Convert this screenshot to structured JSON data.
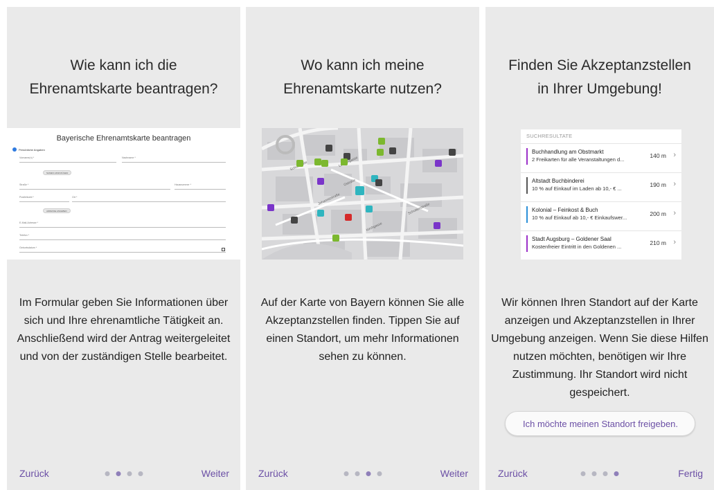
{
  "panels": [
    {
      "title_line1": "Wie kann ich die",
      "title_line2": "Ehrenamtskarte beantragen?",
      "body": "Im Formular geben Sie Informationen über sich und Ihre ehrenamtliche Tätigkeit an. Anschließend wird der Antrag weitergeleitet und von der zuständigen Stelle bearbeitet.",
      "back": "Zurück",
      "next": "Weiter",
      "active_dot": 1
    },
    {
      "title_line1": "Wo kann ich meine",
      "title_line2": "Ehrenamtskarte nutzen?",
      "body": "Auf der Karte von Bayern können Sie alle Akzeptanzstellen finden. Tippen Sie auf einen Standort, um mehr Informationen sehen zu können.",
      "back": "Zurück",
      "next": "Weiter",
      "active_dot": 2
    },
    {
      "title_line1": "Finden Sie Akzeptanzstellen",
      "title_line2": "in Ihrer Umgebung!",
      "body": "Wir können Ihren Standort auf der Karte anzeigen und Akzeptanzstellen in Ihrer Umgebung anzeigen. Wenn Sie diese Hilfen nutzen möchten, benötigen wir Ihre Zustimmung. Ihr Standort wird nicht gespeichert.",
      "location_button": "Ich möchte meinen Standort freigeben.",
      "back": "Zurück",
      "next": "Fertig",
      "active_dot": 3
    }
  ],
  "form_preview": {
    "title": "Bayerische Ehrenamtskarte beantragen",
    "section": "Persönliche Angaben",
    "fields": {
      "vorname": "Vorname(n) *",
      "nachname": "Nachname *",
      "strasse": "Straße *",
      "hausnummer": "Hausnummer *",
      "postleitzahl": "Postleitzahl *",
      "ort": "Ort *",
      "email": "E-Mail-Adresse *",
      "telefon": "Telefon *",
      "geburtsdatum": "Geburtsdatum *"
    },
    "buttons": {
      "name_add": "NAMEN HINZUFÜGEN",
      "address_add": "ADRESSE ANGEBEN"
    }
  },
  "map_preview": {
    "streets": [
      "Schulstraße",
      "Johannisstraße",
      "Ostraße",
      "Lebuchgasse",
      "Schottenstraße",
      "Kirchgasse"
    ]
  },
  "results_preview": {
    "header": "SUCHRESULTATE",
    "items": [
      {
        "name": "Buchhandlung am Obstmarkt",
        "desc": "2 Freikarten für alle Veranstaltungen d...",
        "dist": "140 m",
        "color": "#9b30c9"
      },
      {
        "name": "Altstadt Buchbinderei",
        "desc": "10 % auf Einkauf im Laden ab 10,- € ...",
        "dist": "190 m",
        "color": "#555555"
      },
      {
        "name": "Kolonial – Feinkost & Buch",
        "desc": "10 % auf Einkauf ab 10,- € Einkaufswer...",
        "dist": "200 m",
        "color": "#2a8fd8"
      },
      {
        "name": "Stadt Augsburg – Goldener Saal",
        "desc": "Kostenfreier Eintritt in den Goldenen ...",
        "dist": "210 m",
        "color": "#9b30c9"
      }
    ]
  },
  "colors": {
    "accent": "#6b4fa5",
    "panel_bg": "#eaeaea",
    "dot_active": "#8f7fb9",
    "dot_inactive": "#b7b7c2"
  }
}
